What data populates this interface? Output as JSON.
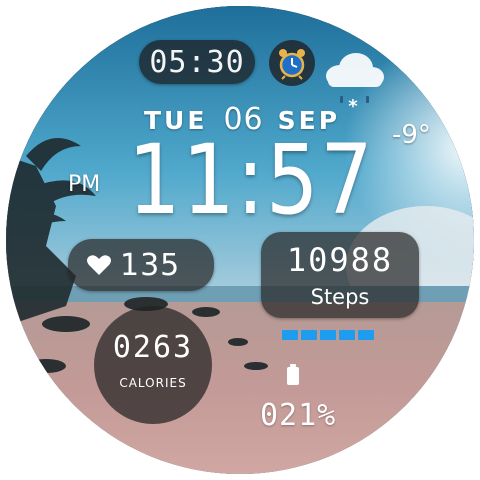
{
  "alarm": {
    "time": "05:30",
    "icon": "alarm-clock-icon"
  },
  "weather": {
    "temperature": "-9°",
    "icon": "snow-cloud-icon"
  },
  "date": {
    "day": "TUE",
    "day_number": "06",
    "month": "SEP"
  },
  "clock": {
    "ampm": "PM",
    "time": "11:57"
  },
  "heart_rate": {
    "value": "135",
    "icon": "heart-icon"
  },
  "steps": {
    "value": "10988",
    "label": "Steps",
    "segments_filled": 5,
    "segments_total": 5,
    "bar_color": "#1e9df0"
  },
  "calories": {
    "value": "0263",
    "label": "CALORIES"
  },
  "battery": {
    "value": "021%",
    "icon": "battery-icon"
  },
  "colors": {
    "accent": "#1e9df0",
    "text": "#ffffff",
    "panel": "#282828"
  }
}
